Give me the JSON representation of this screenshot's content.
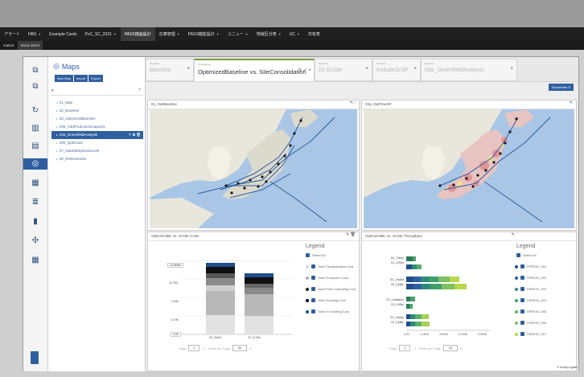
{
  "colors": {
    "accent": "#2f5fa0",
    "active_tab_border": "#7a9a3a"
  },
  "menubar": {
    "items": [
      "アラート",
      "HBS",
      "Example Cards",
      "PoC_SC_2021",
      "PASS描画設計",
      "在庫管理",
      "PASS機能設計",
      "ユニュー",
      "地域区分表",
      "UC",
      "共有表"
    ],
    "active_index": 4
  },
  "subbar": {
    "items": [
      "mation",
      "Stock detail"
    ],
    "active_index": 1
  },
  "maps": {
    "title": "Maps",
    "new_map_button": "New Map",
    "import_button": "Import",
    "export_button": "Export"
  },
  "tree": {
    "items": [
      {
        "label": "01_Map",
        "selected": false
      },
      {
        "label": "02_Baseline",
        "selected": false
      },
      {
        "label": "03_OptimizedBaseline",
        "selected": false
      },
      {
        "label": "03b_AddProductionCapacity",
        "selected": false
      },
      {
        "label": "03a_GreenfieldAnalysis",
        "selected": true
      },
      {
        "label": "03b_OptRoute",
        "selected": false
      },
      {
        "label": "07_OptSafetyStockLevel",
        "selected": false
      },
      {
        "label": "09_NNIventories",
        "selected": false
      }
    ]
  },
  "tabs": [
    {
      "sub": "Scenario",
      "name": "Baseline",
      "active": false
    },
    {
      "sub": "Comparison",
      "name": "OptimizedBaseline vs. SiteConsolidation",
      "active": true
    },
    {
      "sub": "Scenario",
      "name": "02 GrSite",
      "active": false
    },
    {
      "sub": "Scenario",
      "name": "IncludeGrSP",
      "active": false
    },
    {
      "sub": "Scenario",
      "name": "03a_GreenfieldAnalysis",
      "active": false
    }
  ],
  "show_button": "Show/Hide S",
  "panels": {
    "map_left_title": "01_OptBaseline",
    "map_right_title": "03a_OptFlowOF",
    "cost_title": "OptimizedBL vs. GrSite Costs",
    "throughput_title": "OptimizedBL vs. GrSite Throughput"
  },
  "cost_chart": {
    "y_ticks": [
      "14,969M",
      "11,23M",
      "7,49M",
      "3,74M",
      "0,00"
    ],
    "x_labels": [
      "03_OptBL",
      "03_GrSite"
    ],
    "pager": {
      "label": "Page",
      "page": "1",
      "of": "/ 1",
      "rows_label": "Rows per Page",
      "rows": "20"
    }
  },
  "cost_legend": {
    "title": "Legend",
    "select_all": "Select All",
    "items": [
      {
        "label": "Total Transportation Cost",
        "color": "#d8d8d8"
      },
      {
        "label": "Total Production Cost",
        "color": "#b0b0b0"
      },
      {
        "label": "Total Fixed Operating Cost",
        "color": "#222222"
      },
      {
        "label": "Total Sourcing Cost",
        "color": "#000000"
      },
      {
        "label": "Total Inv Holding Cost",
        "color": "#1f4e8a"
      }
    ]
  },
  "throughput_chart": {
    "bar_labels": [
      "DC_Tokyo",
      "01_GrSite",
      "DC_Osaka",
      "03_OptBL",
      "DC_Hokkaido",
      "03_GrSite",
      "DC_Osaka",
      "03_OptBL"
    ],
    "x_ticks": [
      "0.00",
      "2,250K",
      "4,500K",
      "6,750K",
      "9,000K"
    ],
    "pager": {
      "label": "Page",
      "page": "1",
      "of": "/ 1",
      "rows_label": "Rows per Page",
      "rows": "20"
    }
  },
  "throughput_legend": {
    "title": "Legend",
    "select_all": "Select All",
    "items": [
      "PERIOD_001",
      "PERIOD_002",
      "PERIOD_003",
      "PERIOD_004",
      "PERIOD_005",
      "PERIOD_006",
      "PERIOD_007"
    ]
  },
  "status": {
    "text": "© All  anyLogistix"
  }
}
